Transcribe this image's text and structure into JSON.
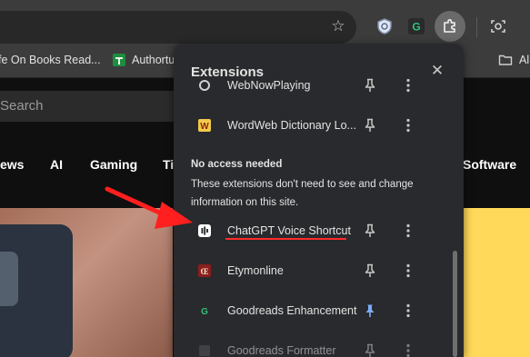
{
  "toolbar": {
    "star_icon": "star-icon",
    "extension_icons": [
      "shield-extension-icon",
      "grammar-extension-icon"
    ],
    "puzzle_icon": "puzzle-icon",
    "screenshot_icon": "screen-capture-icon"
  },
  "bookmarks": {
    "items": [
      {
        "label": "fe On Books Read..."
      },
      {
        "label": "Authortu"
      }
    ],
    "folder_label": "Al"
  },
  "page": {
    "search_placeholder": "Search",
    "nav": [
      "ews",
      "AI",
      "Gaming",
      "Ti",
      "Software"
    ],
    "accent": "#ffd95a"
  },
  "extensions_popup": {
    "title": "Extensions",
    "close_icon": "close-icon",
    "items_top": [
      {
        "name": "WebNowPlaying",
        "pinned": false
      },
      {
        "name": "WordWeb Dictionary Lo...",
        "pinned": false
      }
    ],
    "section": {
      "label": "No access needed",
      "description": "These extensions don't need to see and change information on this site."
    },
    "items_bottom": [
      {
        "name": "ChatGPT Voice Shortcut",
        "pinned": false,
        "highlighted": true
      },
      {
        "name": "Etymonline",
        "pinned": false
      },
      {
        "name": "Goodreads Enhancement",
        "pinned": true
      },
      {
        "name": "Goodreads Formatter",
        "pinned": false
      }
    ],
    "colors": {
      "background": "#292a2d",
      "pinned": "#7cacf8",
      "highlight": "#ff2a2a"
    }
  }
}
